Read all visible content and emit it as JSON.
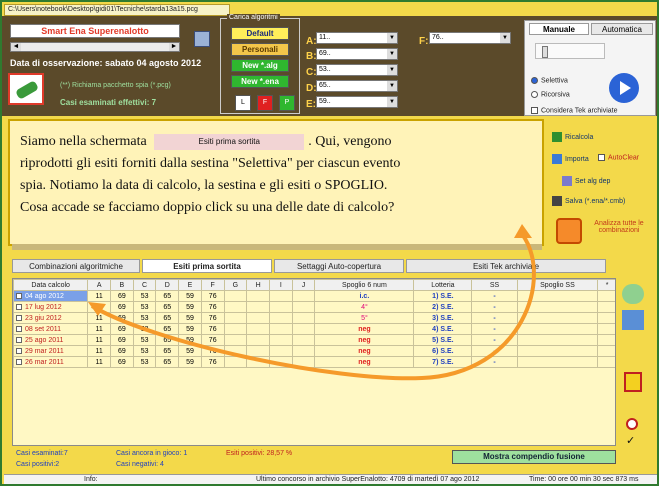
{
  "path": "C:\\Users\\notebook\\Desktop\\gidi01\\Tecniche\\starda13a15.pcg",
  "app_title": "Smart Ena Superenalotto",
  "observation": "Data di osservazione:  sabato 04 agosto 2012",
  "spia": {
    "label": "(**) Richiama pacchetto spia (*.pcg)"
  },
  "casi_esaminati_effettivi": "Casi esaminati effettivi: 7",
  "carica_algoritmi": {
    "label": "Carica algoritmi",
    "buttons": [
      "Default",
      "Personali",
      "New *.alg",
      "New *.ena"
    ],
    "small_buttons": [
      "L",
      "F",
      "P"
    ]
  },
  "combos": [
    {
      "letter": "A:",
      "value": "11.."
    },
    {
      "letter": "B:",
      "value": "69.."
    },
    {
      "letter": "C:",
      "value": "53.."
    },
    {
      "letter": "D:",
      "value": "65.."
    },
    {
      "letter": "E:",
      "value": "59.."
    }
  ],
  "combo_f": {
    "letter": "F:",
    "value": "76.."
  },
  "right_panel": {
    "tabs": [
      "Manuale",
      "Automatica"
    ],
    "radios": [
      "Selettiva",
      "Ricorsiva"
    ],
    "checkbox": "Considera Tek archiviate"
  },
  "note": {
    "line1_a": "Siamo nella schermata",
    "chip": "Esiti prima sortita",
    "line1_b": ". Qui, vengono",
    "line2": "riprodotti gli esiti forniti dalla sestina \"Selettiva\" per ciascun evento",
    "line3": "spia. Notiamo la data di calcolo, la sestina e gli esiti o SPOGLIO.",
    "line4": "Cosa accade se facciamo doppio click su una delle date di calcolo?"
  },
  "side_tools": {
    "ricalcola": "Ricalcola",
    "importa": "Importa",
    "autoclear": "AutoClear",
    "set_alg_dep": "Set alg dep",
    "salva": "Salva (*.ena/*.cmb)",
    "analizza": "Analizza tutte le combinazioni"
  },
  "tabs": [
    "Combinazioni algoritmiche",
    "Esiti prima sortita",
    "Settaggi Auto-copertura",
    "Esiti Tek archiviate"
  ],
  "table": {
    "headers": [
      "Data calcolo",
      "A",
      "B",
      "C",
      "D",
      "E",
      "F",
      "G",
      "H",
      "I",
      "J",
      "Spoglio 6 num",
      "Lotteria",
      "SS",
      "Spoglio SS",
      "*"
    ],
    "rows": [
      {
        "date": "04 ago 2012",
        "A": "11",
        "B": "69",
        "C": "53",
        "D": "65",
        "E": "59",
        "F": "76",
        "spoglio": "i.c.",
        "lotteria": "1) S.E.",
        "ss": "-"
      },
      {
        "date": "17 lug 2012",
        "A": "11",
        "B": "69",
        "C": "53",
        "D": "65",
        "E": "59",
        "F": "76",
        "spoglio": "4°",
        "lotteria": "2) S.E.",
        "ss": "-"
      },
      {
        "date": "23 giu 2012",
        "A": "11",
        "B": "69",
        "C": "53",
        "D": "65",
        "E": "59",
        "F": "76",
        "spoglio": "5°",
        "lotteria": "3) S.E.",
        "ss": "-"
      },
      {
        "date": "08 set 2011",
        "A": "11",
        "B": "69",
        "C": "53",
        "D": "65",
        "E": "59",
        "F": "76",
        "spoglio": "neg",
        "lotteria": "4) S.E.",
        "ss": "-"
      },
      {
        "date": "25 ago 2011",
        "A": "11",
        "B": "69",
        "C": "53",
        "D": "65",
        "E": "59",
        "F": "76",
        "spoglio": "neg",
        "lotteria": "5) S.E.",
        "ss": "-"
      },
      {
        "date": "29 mar 2011",
        "A": "11",
        "B": "69",
        "C": "53",
        "D": "65",
        "E": "59",
        "F": "76",
        "spoglio": "neg",
        "lotteria": "6) S.E.",
        "ss": "-"
      },
      {
        "date": "26 mar 2011",
        "A": "11",
        "B": "69",
        "C": "53",
        "D": "65",
        "E": "59",
        "F": "76",
        "spoglio": "neg",
        "lotteria": "7) S.E.",
        "ss": "-"
      }
    ]
  },
  "stats": {
    "casi_esaminati": "Casi esaminati:7",
    "casi_positivi": "Casi positivi:2",
    "casi_ancora": "Casi ancora in gioco: 1",
    "casi_negativi": "Casi negativi: 4",
    "esiti_positivi": "Esiti positivi: 28,57 %"
  },
  "mostra_button": "Mostra compendio fusione",
  "statusbar": {
    "info": "Info:",
    "ultimo": "Ultimo concorso in archivio SuperEnalotto: 4709 di martedì 07 ago 2012",
    "time": "Time: 00 ore 00 min 30 sec 873 ms"
  }
}
